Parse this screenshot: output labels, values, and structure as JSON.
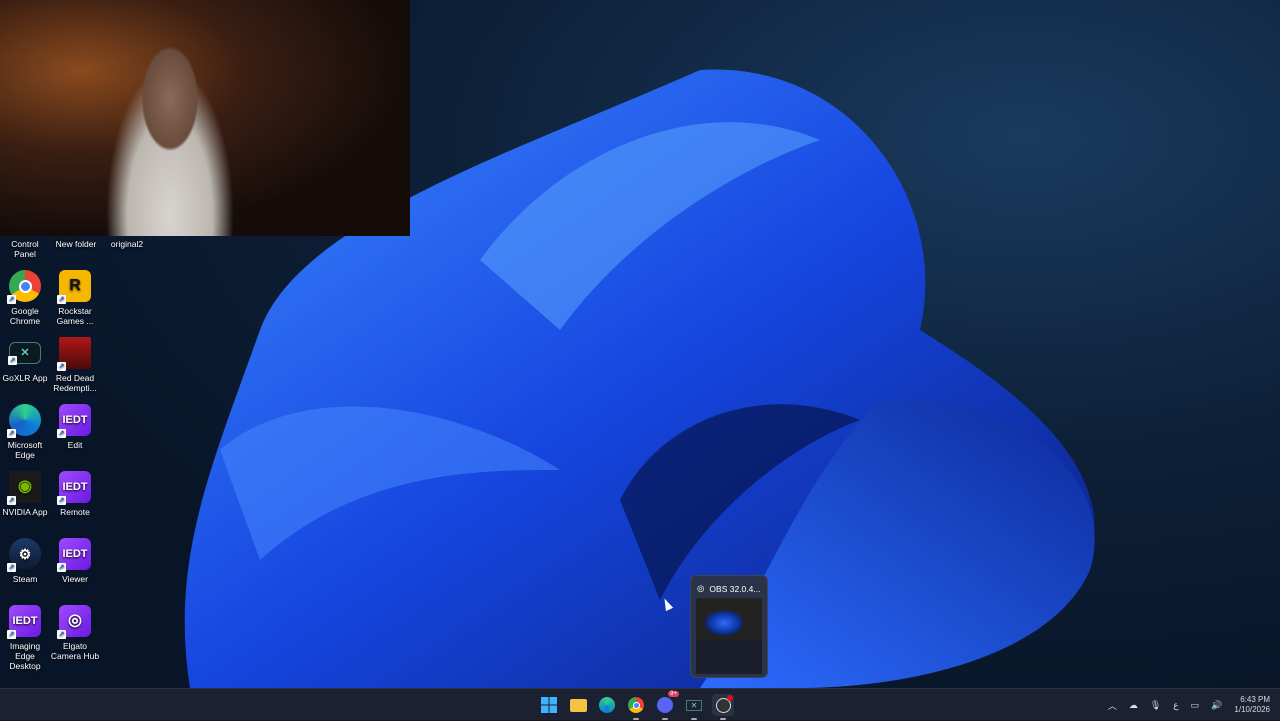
{
  "desktop": {
    "top_labels": [
      "Control Panel",
      "New folder",
      "original2"
    ],
    "icons": [
      {
        "label": "Google Chrome",
        "icon": "chrome-icon"
      },
      {
        "label": "Rockstar Games ...",
        "icon": "rockstar-icon"
      },
      {
        "label": "GoXLR App",
        "icon": "goxlr-icon"
      },
      {
        "label": "Red Dead Redempti...",
        "icon": "red-dead-icon"
      },
      {
        "label": "Microsoft Edge",
        "icon": "edge-icon"
      },
      {
        "label": "Edit",
        "icon": "iedt-icon",
        "glyph": "IEDT"
      },
      {
        "label": "NVIDIA App",
        "icon": "nvidia-icon"
      },
      {
        "label": "Remote",
        "icon": "iedt-icon",
        "glyph": "IEDT"
      },
      {
        "label": "Steam",
        "icon": "steam-icon"
      },
      {
        "label": "Viewer",
        "icon": "iedt-icon",
        "glyph": "IEDT"
      },
      {
        "label": "Imaging Edge Desktop",
        "icon": "iedt-icon",
        "glyph": "IEDT"
      },
      {
        "label": "Elgato Camera Hub",
        "icon": "elgato-icon"
      }
    ]
  },
  "preview": {
    "title": "OBS 32.0.4..."
  },
  "taskbar": {
    "apps": [
      "start",
      "file-explorer",
      "edge",
      "chrome",
      "discord",
      "goxlr",
      "obs"
    ],
    "discord_badge": "9+"
  },
  "tray": {
    "ime": "ع",
    "time": "6:43 PM",
    "date": "1/10/2026"
  }
}
